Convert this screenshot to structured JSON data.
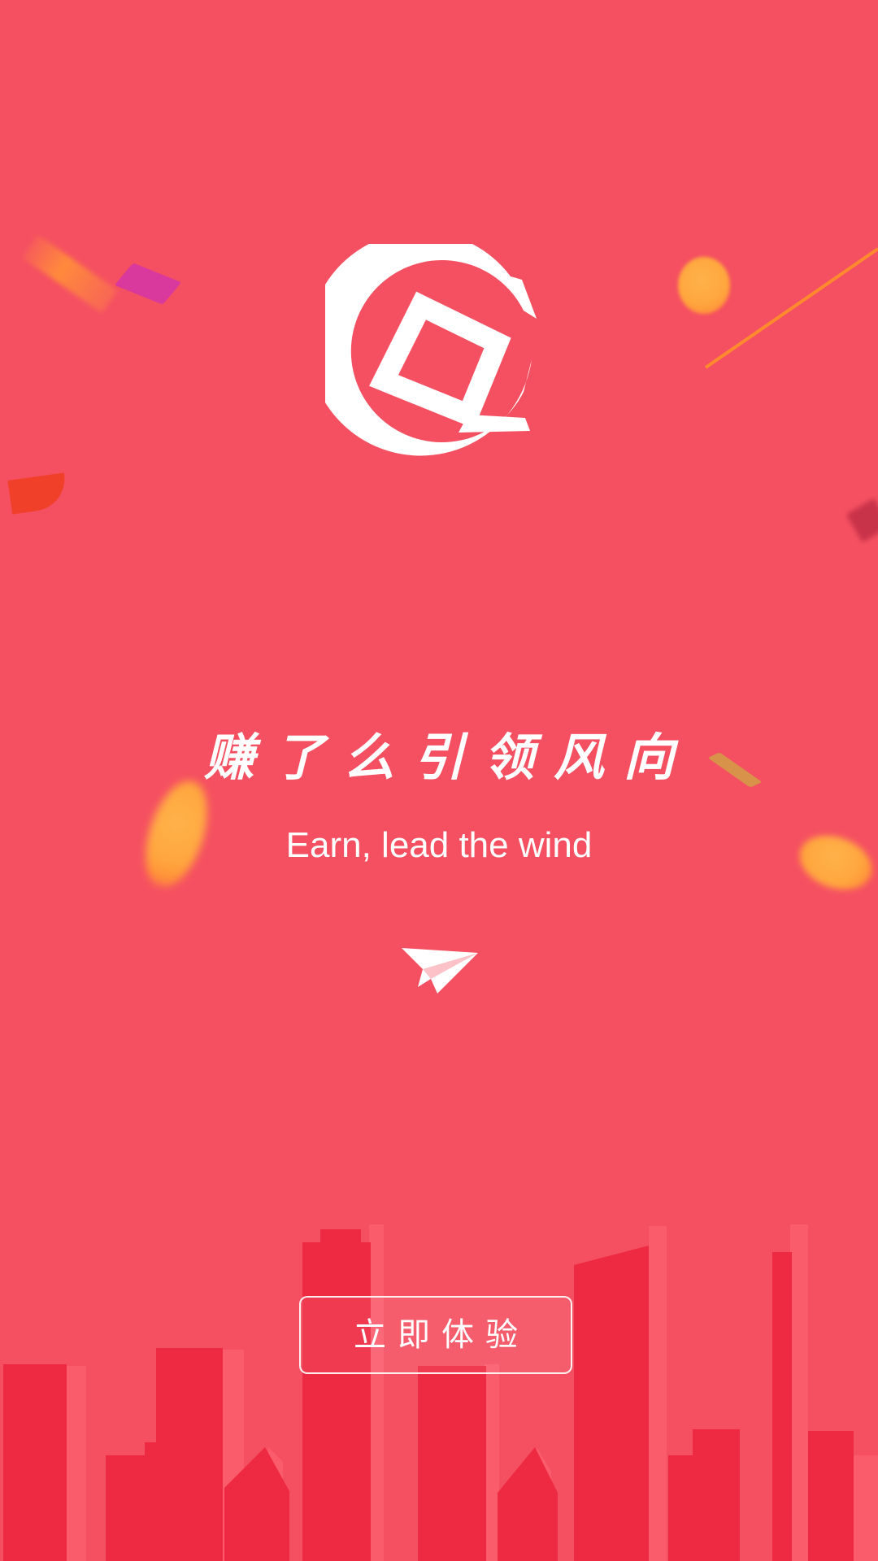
{
  "app": {
    "slogan_cn": "赚了么引领风向",
    "slogan_en": "Earn, lead the wind"
  },
  "cta": {
    "label": "立即体验"
  },
  "icons": {
    "logo": "brand-logo-icon",
    "plane": "paper-plane-icon"
  },
  "colors": {
    "background": "#F55061",
    "building_dark": "#EE2A42",
    "building_light": "#FB5C6C",
    "coin": "#FFA63E",
    "text": "#FFFFFF"
  }
}
